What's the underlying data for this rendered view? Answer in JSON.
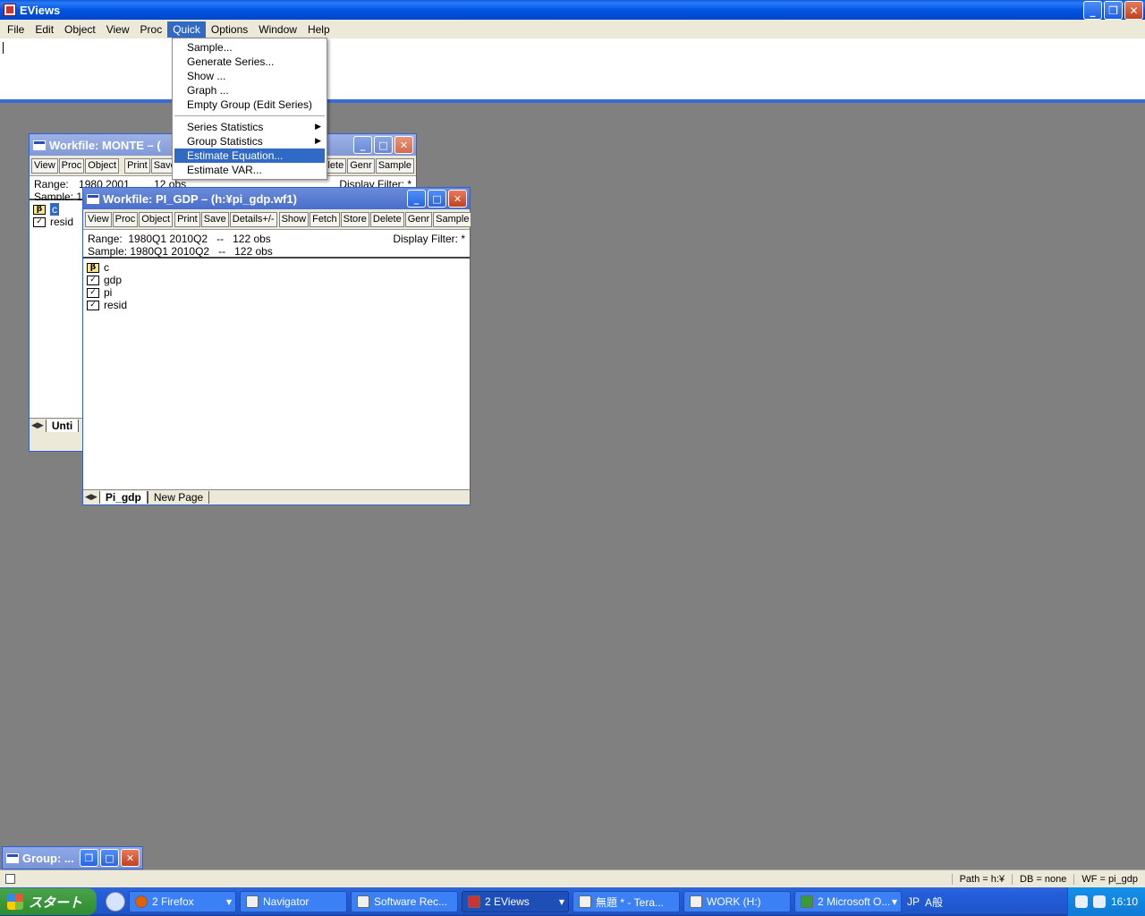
{
  "app": {
    "title": "EViews"
  },
  "title_buttons": {
    "minimize": "_",
    "restore": "❐",
    "close": "✕"
  },
  "menubar": [
    "File",
    "Edit",
    "Object",
    "View",
    "Proc",
    "Quick",
    "Options",
    "Window",
    "Help"
  ],
  "quick_menu": {
    "items": [
      {
        "label": "Sample...",
        "submenu": false
      },
      {
        "label": "Generate Series...",
        "submenu": false
      },
      {
        "label": "Show ...",
        "submenu": false
      },
      {
        "label": "Graph ...",
        "submenu": false
      },
      {
        "label": "Empty Group (Edit Series)",
        "submenu": false
      },
      {
        "label": "Series Statistics",
        "submenu": true
      },
      {
        "label": "Group Statistics",
        "submenu": true
      },
      {
        "label": "Estimate Equation...",
        "submenu": false,
        "highlighted": true
      },
      {
        "label": "Estimate VAR...",
        "submenu": false
      }
    ]
  },
  "workfile_monte": {
    "title": "Workfile: MONTE – (",
    "toolbar": [
      "View",
      "Proc",
      "Object",
      "Print",
      "Save",
      "elete",
      "Genr",
      "Sample"
    ],
    "range_label": "Range:",
    "range_value": "1980 2001",
    "obs": "12 obs",
    "sample_label": "Sample: 1",
    "filter": "Display Filter: *",
    "objects": [
      {
        "icon": "β",
        "name": "c"
      },
      {
        "icon": "✓",
        "name": "resid"
      }
    ],
    "tab": "Unti"
  },
  "workfile_pigdp": {
    "title": "Workfile: PI_GDP – (h:¥pi_gdp.wf1)",
    "toolbar": [
      "View",
      "Proc",
      "Object",
      "Print",
      "Save",
      "Details+/-",
      "Show",
      "Fetch",
      "Store",
      "Delete",
      "Genr",
      "Sample"
    ],
    "range": "Range:  1980Q1 2010Q2   --   122 obs",
    "sample": "Sample: 1980Q1 2010Q2   --   122 obs",
    "filter": "Display Filter: *",
    "objects": [
      {
        "icon": "β",
        "name": "c"
      },
      {
        "icon": "✓",
        "name": "gdp"
      },
      {
        "icon": "✓",
        "name": "pi"
      },
      {
        "icon": "✓",
        "name": "resid"
      }
    ],
    "tabs": [
      "Pi_gdp",
      "New Page"
    ]
  },
  "minimized_window": {
    "title": "Group: ..."
  },
  "statusbar": {
    "path": "Path = h:¥",
    "db": "DB = none",
    "wf": "WF = pi_gdp"
  },
  "taskbar": {
    "start": "スタート",
    "tasks": [
      {
        "label": "2 Firefox",
        "dropdown": true
      },
      {
        "label": "Navigator",
        "dropdown": false
      },
      {
        "label": "Software Rec...",
        "dropdown": false
      },
      {
        "label": "2 EViews",
        "dropdown": true,
        "active": true
      },
      {
        "label": "無題 * - Tera...",
        "dropdown": false
      },
      {
        "label": "WORK (H:)",
        "dropdown": false
      },
      {
        "label": "2 Microsoft O...",
        "dropdown": true
      }
    ],
    "ime": [
      "JP",
      "A般"
    ],
    "clock": "16:10"
  }
}
